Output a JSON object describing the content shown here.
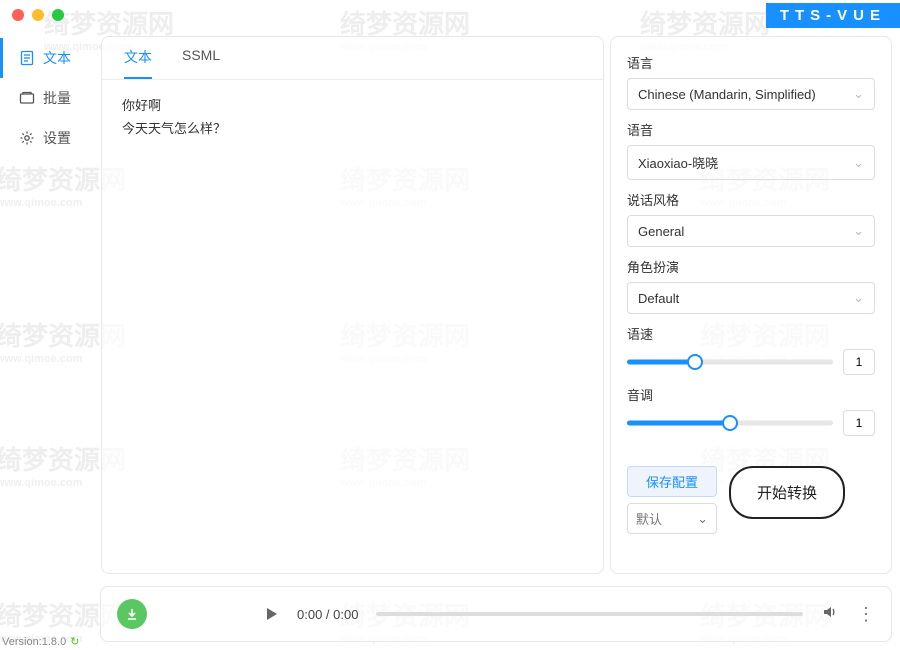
{
  "app": {
    "title": "TTS-VUE"
  },
  "sidebar": {
    "items": [
      {
        "label": "文本",
        "active": true
      },
      {
        "label": "批量",
        "active": false
      },
      {
        "label": "设置",
        "active": false
      }
    ]
  },
  "center": {
    "tabs": [
      {
        "label": "文本",
        "active": true
      },
      {
        "label": "SSML",
        "active": false
      }
    ],
    "text_lines": [
      "你好啊",
      "今天天气怎么样？"
    ]
  },
  "right": {
    "language": {
      "label": "语言",
      "value": "Chinese (Mandarin, Simplified)"
    },
    "voice": {
      "label": "语音",
      "value": "Xiaoxiao-晓晓"
    },
    "style": {
      "label": "说话风格",
      "value": "General"
    },
    "role": {
      "label": "角色扮演",
      "value": "Default"
    },
    "speed": {
      "label": "语速",
      "value": "1",
      "percent": 33
    },
    "pitch": {
      "label": "音调",
      "value": "1",
      "percent": 50
    },
    "save_config": "保存配置",
    "preset": "默认",
    "start": "开始转换"
  },
  "player": {
    "time": "0:00 / 0:00"
  },
  "footer": {
    "version": "Version:1.8.0"
  },
  "watermark": {
    "text": "绮梦资源网",
    "sub": "www.qimoe.com"
  }
}
